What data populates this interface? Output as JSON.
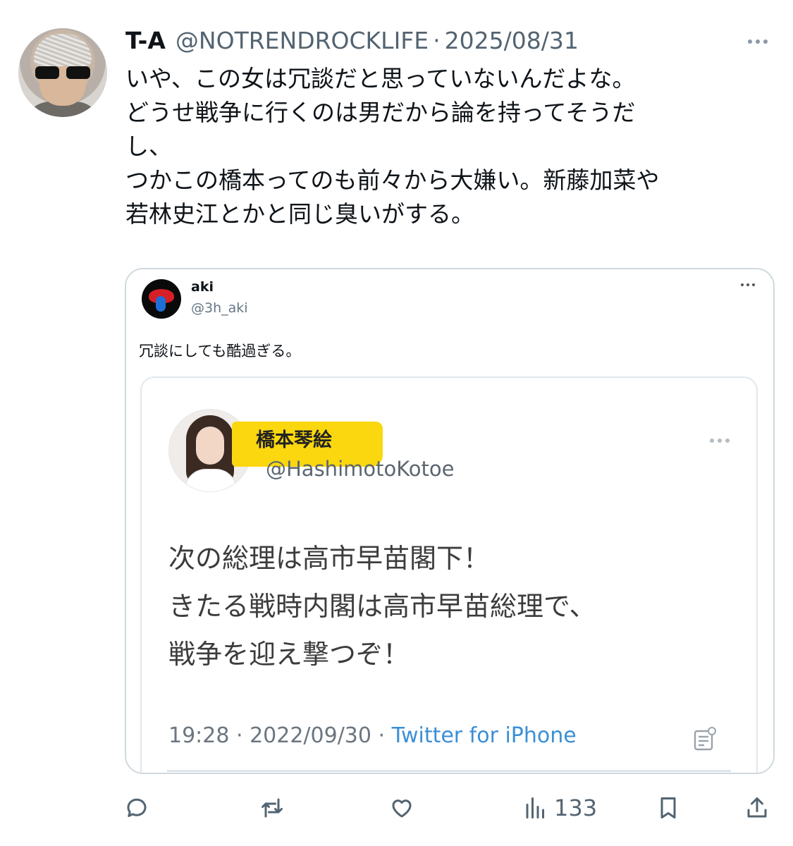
{
  "tweet": {
    "author_name": "T-A",
    "author_handle": "@NOTRENDROCKLIFE",
    "separator": "·",
    "date": "2025/08/31",
    "lines": [
      "いや、この女は冗談だと思っていないんだよな。",
      "どうせ戦争に行くのは男だから論を持ってそうだ",
      "し、",
      "つかこの橋本ってのも前々から大嫌い。新藤加菜や"
    ],
    "last_line_highlight": "若林史江",
    "last_line_rest": "とかと同じ臭いがする。"
  },
  "quote": {
    "name": "aki",
    "handle": "@3h_aki",
    "text": "冗談にしても酷過ぎる。",
    "inner": {
      "name": "橋本琴絵",
      "handle": "@HashimotoKotoe",
      "lines": [
        "次の総理は高市早苗閣下！",
        "きたる戦時内閣は高市早苗総理で、",
        "戦争を迎え撃つぞ！"
      ],
      "time": "19:28 · 2022/09/30 · ",
      "source": "Twitter for iPhone"
    }
  },
  "actions": {
    "views_count": "133",
    "icons": [
      "reply-icon",
      "retweet-icon",
      "like-icon",
      "views-icon",
      "bookmark-icon",
      "share-icon"
    ]
  },
  "colors": {
    "highlight": "#fbd70f",
    "muted": "#536471",
    "link": "#3b8fd6"
  }
}
